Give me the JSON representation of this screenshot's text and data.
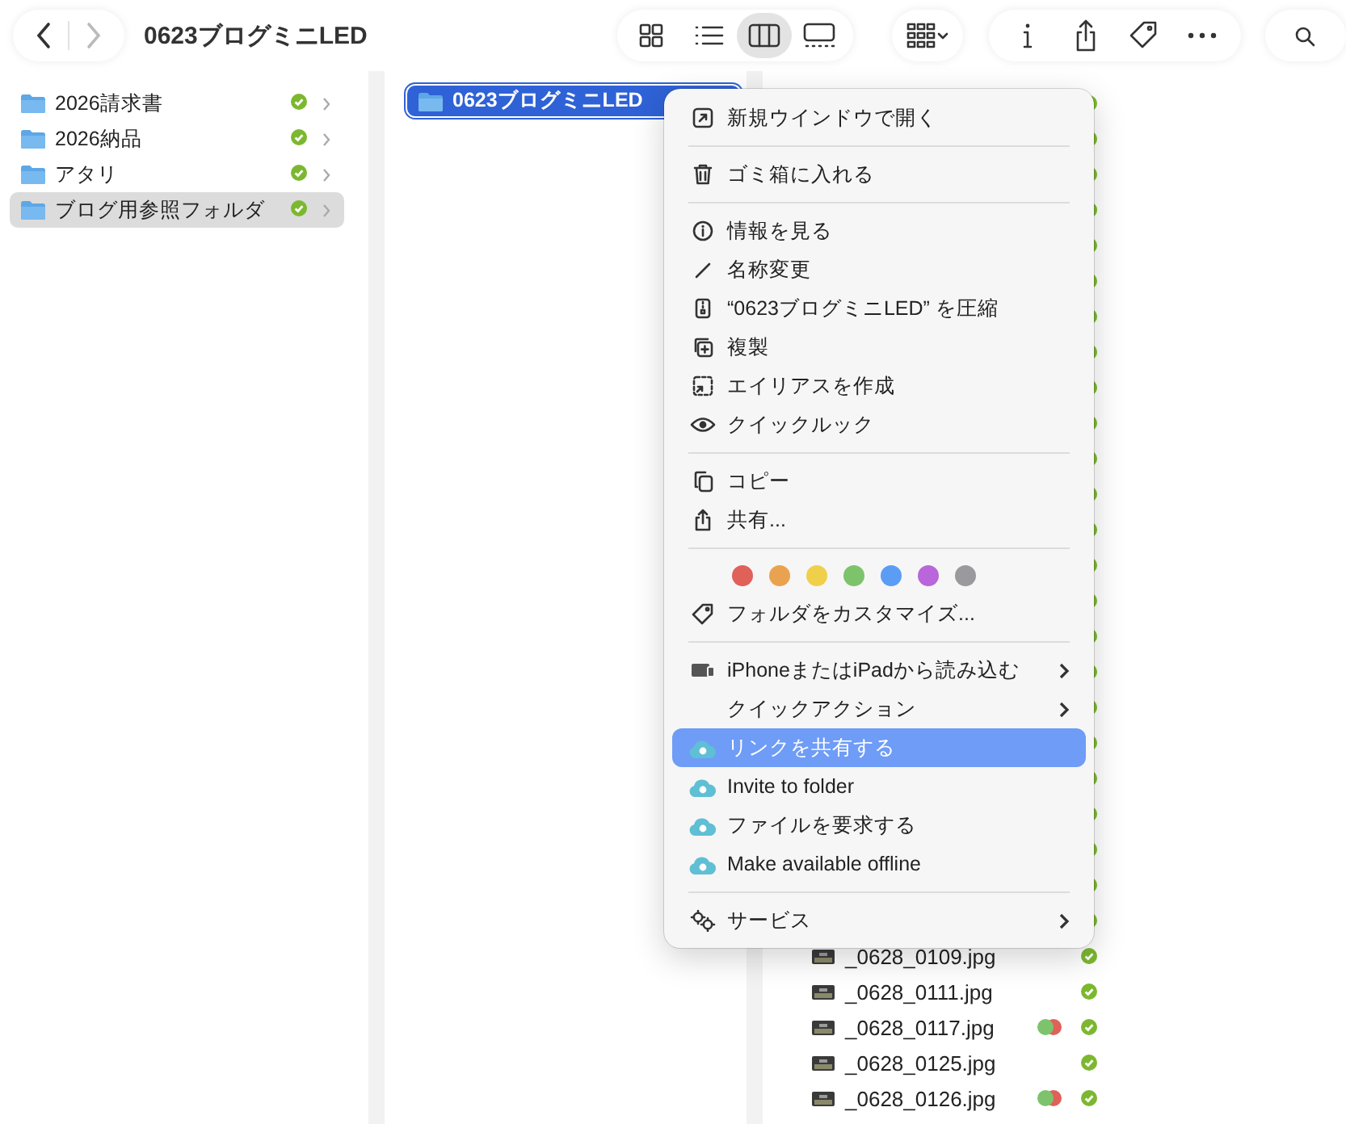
{
  "toolbar": {
    "title": "0623ブログミニLED",
    "nav": [
      {
        "kind": "back",
        "disabled": false
      },
      {
        "kind": "forward",
        "disabled": true
      }
    ],
    "views": [
      {
        "kind": "icons",
        "selected": false
      },
      {
        "kind": "list",
        "selected": false
      },
      {
        "kind": "columns",
        "selected": true
      },
      {
        "kind": "gallery",
        "selected": false
      }
    ],
    "buttons": [
      {
        "kind": "group"
      },
      {
        "kind": "info"
      },
      {
        "kind": "share"
      },
      {
        "kind": "tag"
      },
      {
        "kind": "more"
      },
      {
        "kind": "search"
      }
    ]
  },
  "sidebar": {
    "items": [
      {
        "label": "2026請求書",
        "selected": false,
        "synced": true
      },
      {
        "label": "2026納品",
        "selected": false,
        "synced": true
      },
      {
        "label": "アタリ",
        "selected": false,
        "synced": true
      },
      {
        "label": "ブログ用参照フォルダ",
        "selected": true,
        "synced": true
      }
    ]
  },
  "column": {
    "items": [
      {
        "label": "0623ブログミニLED",
        "selected": true
      }
    ]
  },
  "files": [
    {
      "synced": true
    },
    {
      "synced": true
    },
    {
      "synced": true
    },
    {
      "synced": true
    },
    {
      "synced": true
    },
    {
      "synced": true
    },
    {
      "synced": true
    },
    {
      "synced": true
    },
    {
      "synced": true
    },
    {
      "synced": true
    },
    {
      "synced": true
    },
    {
      "synced": true
    },
    {
      "synced": true
    },
    {
      "synced": true
    },
    {
      "synced": true
    },
    {
      "synced": true
    },
    {
      "synced": true
    },
    {
      "synced": true
    },
    {
      "synced": true
    },
    {
      "synced": true
    },
    {
      "synced": true
    },
    {
      "synced": true
    },
    {
      "synced": true
    },
    {
      "synced": true
    },
    {
      "name": "_0628_0109.jpg",
      "synced": true
    },
    {
      "name": "_0628_0111.jpg",
      "synced": true
    },
    {
      "name": "_0628_0117.jpg",
      "synced": true,
      "tags": [
        {
          "color": "#7dc36b"
        },
        {
          "color": "#e0605a"
        }
      ]
    },
    {
      "name": "_0628_0125.jpg",
      "synced": true
    },
    {
      "name": "_0628_0126.jpg",
      "synced": true,
      "tags": [
        {
          "color": "#7dc36b"
        },
        {
          "color": "#e0605a"
        }
      ]
    }
  ],
  "context_menu": {
    "items": [
      {
        "kind": "item",
        "label": "新規ウインドウで開く",
        "submenu": false,
        "selected": false
      },
      {
        "kind": "separator"
      },
      {
        "kind": "item",
        "label": "ゴミ箱に入れる",
        "submenu": false,
        "selected": false
      },
      {
        "kind": "separator"
      },
      {
        "kind": "item",
        "label": "情報を見る",
        "submenu": false,
        "selected": false
      },
      {
        "kind": "item",
        "label": "名称変更",
        "submenu": false,
        "selected": false
      },
      {
        "kind": "item",
        "label": "“0623ブログミニLED” を圧縮",
        "submenu": false,
        "selected": false
      },
      {
        "kind": "item",
        "label": "複製",
        "submenu": false,
        "selected": false
      },
      {
        "kind": "item",
        "label": "エイリアスを作成",
        "submenu": false,
        "selected": false
      },
      {
        "kind": "item",
        "label": "クイックルック",
        "submenu": false,
        "selected": false
      },
      {
        "kind": "separator"
      },
      {
        "kind": "item",
        "label": "コピー",
        "submenu": false,
        "selected": false
      },
      {
        "kind": "item",
        "label": "共有...",
        "submenu": false,
        "selected": false
      },
      {
        "kind": "separator"
      },
      {
        "kind": "colors",
        "colors": [
          {
            "color": "#e0605a"
          },
          {
            "color": "#e9a24f"
          },
          {
            "color": "#f0cf4a"
          },
          {
            "color": "#7dc36b"
          },
          {
            "color": "#5b9cf5"
          },
          {
            "color": "#b866d9"
          },
          {
            "color": "#9a9a9e"
          }
        ]
      },
      {
        "kind": "item",
        "label": "フォルダをカスタマイズ...",
        "submenu": false,
        "selected": false
      },
      {
        "kind": "separator"
      },
      {
        "kind": "item",
        "label": "iPhoneまたはiPadから読み込む",
        "submenu": true,
        "selected": false
      },
      {
        "kind": "item",
        "label": "クイックアクション",
        "submenu": true,
        "selected": false
      },
      {
        "kind": "cloud",
        "label": "リンクを共有する",
        "submenu": false,
        "selected": true
      },
      {
        "kind": "cloud",
        "label": "Invite to folder",
        "submenu": false,
        "selected": false
      },
      {
        "kind": "cloud",
        "label": "ファイルを要求する",
        "submenu": false,
        "selected": false
      },
      {
        "kind": "cloud",
        "label": "Make available offline",
        "submenu": false,
        "selected": false
      },
      {
        "kind": "separator"
      },
      {
        "kind": "item",
        "label": "サービス",
        "submenu": true,
        "selected": false
      }
    ]
  }
}
